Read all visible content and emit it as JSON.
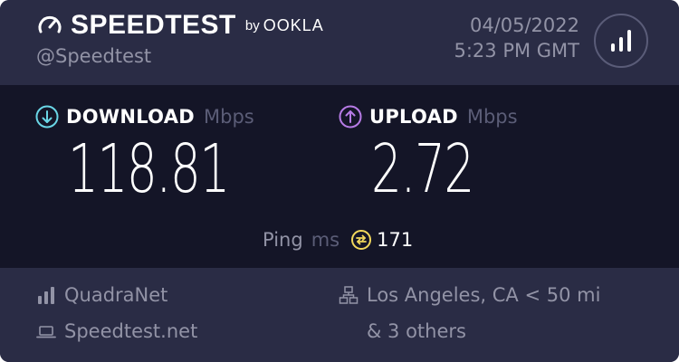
{
  "header": {
    "brand": "SPEEDTEST",
    "by": "by",
    "ookla": "OOKLA",
    "handle": "@Speedtest",
    "date": "04/05/2022",
    "time": "5:23 PM GMT"
  },
  "download": {
    "label": "DOWNLOAD",
    "unit": "Mbps",
    "value": "118.81"
  },
  "upload": {
    "label": "UPLOAD",
    "unit": "Mbps",
    "value": "2.72"
  },
  "ping": {
    "label": "Ping",
    "unit": "ms",
    "value": "171"
  },
  "footer": {
    "isp": "QuadraNet",
    "site": "Speedtest.net",
    "server_location": "Los Angeles, CA < 50 mi",
    "server_others": "& 3 others"
  },
  "colors": {
    "download_accent": "#6ad6e6",
    "upload_accent": "#b77be6",
    "ping_accent": "#f2d85c",
    "header_bg": "#2a2c45",
    "main_bg": "#141527"
  },
  "icons": {
    "logo": "gauge-icon",
    "results": "bar-chart-icon",
    "download": "arrow-down-circle-icon",
    "upload": "arrow-up-circle-icon",
    "ping": "ping-icon",
    "isp": "signal-icon",
    "site": "laptop-icon",
    "server": "server-icon"
  }
}
